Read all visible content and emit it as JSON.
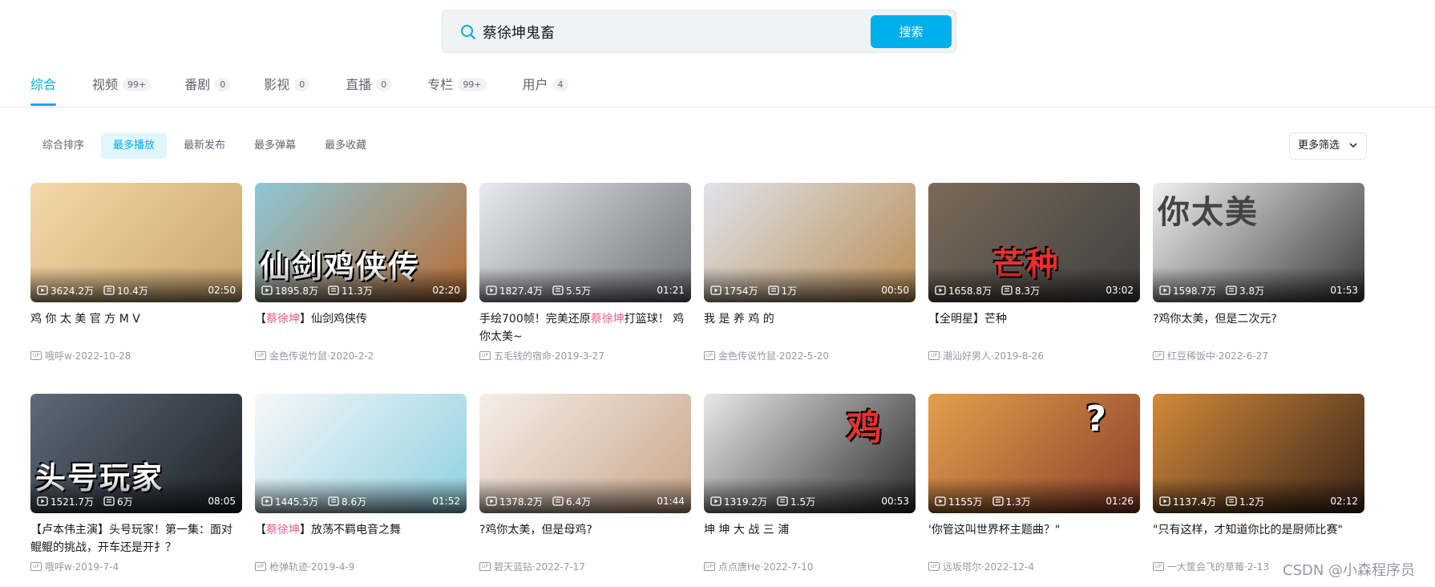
{
  "search": {
    "value": "蔡徐坤鬼畜",
    "button": "搜索"
  },
  "tabs": [
    {
      "label": "综合",
      "count": ""
    },
    {
      "label": "视频",
      "count": "99+"
    },
    {
      "label": "番剧",
      "count": "0"
    },
    {
      "label": "影视",
      "count": "0"
    },
    {
      "label": "直播",
      "count": "0"
    },
    {
      "label": "专栏",
      "count": "99+"
    },
    {
      "label": "用户",
      "count": "4"
    }
  ],
  "sort": [
    "综合排序",
    "最多播放",
    "最新发布",
    "最多弹幕",
    "最多收藏"
  ],
  "filter_label": "更多筛选",
  "videos": [
    {
      "pre": "鸡 你 太 美 官 方 M V",
      "hl": "",
      "post": "",
      "views": "3624.2万",
      "danmaku": "10.4万",
      "duration": "02:50",
      "author": "哦呼w",
      "date": "2022-10-28",
      "overlay": "",
      "colors": [
        "#f4d8a8",
        "#c9a56e"
      ]
    },
    {
      "pre": "【",
      "hl": "蔡徐坤",
      "post": "】仙剑鸡侠传",
      "views": "1895.8万",
      "danmaku": "11.3万",
      "duration": "02:20",
      "author": "金色传说竹鼠",
      "date": "2020-2-2",
      "overlay": "仙剑鸡侠传",
      "colors": [
        "#8ec7d8",
        "#b66c34"
      ]
    },
    {
      "pre": "手绘700帧！完美还原",
      "hl": "蔡徐坤",
      "post": "打篮球！ 鸡你太美~",
      "views": "1827.4万",
      "danmaku": "5.5万",
      "duration": "01:21",
      "author": "五毛钱的宿命",
      "date": "2019-3-27",
      "overlay": "",
      "colors": [
        "#e9eaf0",
        "#6f6f78"
      ]
    },
    {
      "pre": "我 是 养 鸡 的",
      "hl": "",
      "post": "",
      "views": "1754万",
      "danmaku": "1万",
      "duration": "00:50",
      "author": "金色传说竹鼠",
      "date": "2022-5-20",
      "overlay": "",
      "colors": [
        "#dfe3ea",
        "#b98d55"
      ]
    },
    {
      "pre": "【全明星】芒种",
      "hl": "",
      "post": "",
      "views": "1658.8万",
      "danmaku": "8.3万",
      "duration": "03:02",
      "author": "潮汕好男人",
      "date": "2019-8-26",
      "overlay": "芒种",
      "colors": [
        "#7a6a5a",
        "#40403e"
      ]
    },
    {
      "pre": "?鸡你太美，但是二次元?",
      "hl": "",
      "post": "",
      "views": "1598.7万",
      "danmaku": "3.8万",
      "duration": "01:53",
      "author": "红豆稀饭中",
      "date": "2022-6-27",
      "overlay": "你太美",
      "colors": [
        "#f0f0f0",
        "#3a3a3a"
      ]
    },
    {
      "pre": "【卢本伟主演】头号玩家！第一集：面对鲲鲲的挑战，开车还是开扌？",
      "hl": "",
      "post": "",
      "views": "1521.7万",
      "danmaku": "6万",
      "duration": "08:05",
      "author": "哦呼w",
      "date": "2019-7-4",
      "overlay": "头号玩家",
      "colors": [
        "#5e6a78",
        "#1d2228"
      ]
    },
    {
      "pre": "【",
      "hl": "蔡徐坤",
      "post": "】放荡不羁电音之舞",
      "views": "1445.5万",
      "danmaku": "8.6万",
      "duration": "01:52",
      "author": "枪弹轨迹",
      "date": "2019-4-9",
      "overlay": "",
      "colors": [
        "#f6f7f9",
        "#8fd0e0"
      ]
    },
    {
      "pre": "?鸡你太美，但是母鸡?",
      "hl": "",
      "post": "",
      "views": "1378.2万",
      "danmaku": "6.4万",
      "duration": "01:44",
      "author": "碧天蓝钻",
      "date": "2022-7-17",
      "overlay": "",
      "colors": [
        "#f5eee8",
        "#c9a58a"
      ]
    },
    {
      "pre": "坤 坤 大 战 三 浦",
      "hl": "",
      "post": "",
      "views": "1319.2万",
      "danmaku": "1.5万",
      "duration": "00:53",
      "author": "点点唐He",
      "date": "2022-7-10",
      "overlay": "鸡",
      "colors": [
        "#e8e8e8",
        "#2a2a2a"
      ]
    },
    {
      "pre": "'你管这叫世界杯主题曲？\"",
      "hl": "",
      "post": "",
      "views": "1155万",
      "danmaku": "1.3万",
      "duration": "01:26",
      "author": "远坂塔尔",
      "date": "2022-12-4",
      "overlay": "?",
      "colors": [
        "#e2a04c",
        "#8c3f2a"
      ]
    },
    {
      "pre": "\"只有这样，才知道你比的是厨师比赛\"",
      "hl": "",
      "post": "",
      "views": "1137.4万",
      "danmaku": "1.2万",
      "duration": "02:12",
      "author": "一大筐会飞的草莓",
      "date": "2-13",
      "overlay": "",
      "colors": [
        "#d28a3a",
        "#3a2418"
      ]
    }
  ],
  "watermark": "CSDN @小森程序员"
}
